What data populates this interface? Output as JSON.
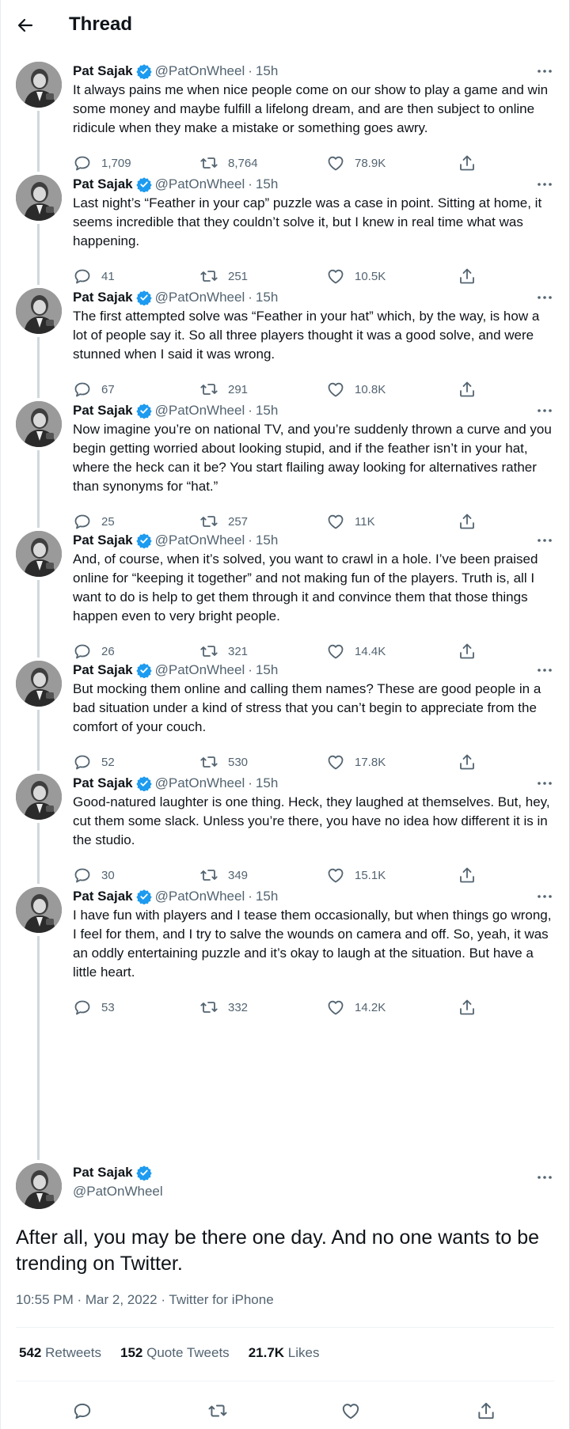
{
  "header": {
    "title": "Thread"
  },
  "author": {
    "name": "Pat Sajak",
    "handle": "@PatOnWheel",
    "time": "15h",
    "separator": "·"
  },
  "thread": [
    {
      "text": "It always pains me when nice people come on our show to play a game and win some money and maybe fulfill a lifelong dream, and are then subject to online ridicule when they make a mistake or something goes awry.",
      "replies": "1,709",
      "retweets": "8,764",
      "likes": "78.9K"
    },
    {
      "text": "Last night’s “Feather in your cap” puzzle was a case in point. Sitting at home, it seems incredible that they couldn’t solve it, but I knew in real time what was happening.",
      "replies": "41",
      "retweets": "251",
      "likes": "10.5K"
    },
    {
      "text": "The first attempted solve was “Feather in your hat” which, by the way, is how a lot of people say it. So all three players thought it was a good solve, and were stunned when I said it was wrong.",
      "replies": "67",
      "retweets": "291",
      "likes": "10.8K"
    },
    {
      "text": "Now imagine you’re on national TV, and you’re suddenly thrown a curve and you begin getting worried about looking stupid, and if the feather isn’t in your hat, where the heck can it be? You start flailing away looking for alternatives rather than synonyms for “hat.”",
      "replies": "25",
      "retweets": "257",
      "likes": "11K"
    },
    {
      "text": "And, of course, when it’s solved, you want to crawl in a hole. I’ve been praised online for “keeping it together” and not making fun of the players. Truth is, all I want to do is help to get them through it and convince them that those things happen even to very bright people.",
      "replies": "26",
      "retweets": "321",
      "likes": "14.4K"
    },
    {
      "text": "But mocking them online and calling them names? These are good people in a bad situation under a kind of stress that you can’t begin to appreciate from the comfort of your couch.",
      "replies": "52",
      "retweets": "530",
      "likes": "17.8K"
    },
    {
      "text": "Good-natured laughter is one thing. Heck, they laughed at themselves. But, hey, cut them some slack. Unless you’re there, you have no idea how different it is in the studio.",
      "replies": "30",
      "retweets": "349",
      "likes": "15.1K"
    },
    {
      "text": "I have fun with players and I tease them occasionally, but when things go wrong, I feel for them, and I try to salve the wounds on camera and off. So, yeah, it was an oddly entertaining puzzle and it’s okay to laugh at the situation. But have a little heart.",
      "replies": "53",
      "retweets": "332",
      "likes": "14.2K"
    }
  ],
  "main": {
    "text": "After all, you may be there one day. And no one wants to be trending on Twitter.",
    "timestamp": "10:55 PM · Mar 2, 2022 · Twitter for iPhone",
    "retweets_count": "542",
    "retweets_label": "Retweets",
    "quotes_count": "152",
    "quotes_label": "Quote Tweets",
    "likes_count": "21.7K",
    "likes_label": "Likes"
  },
  "colors": {
    "verified": "#1d9bf0",
    "secondary": "#536471",
    "line": "#cfd9de"
  },
  "icons": [
    "back-arrow-icon",
    "verified-icon",
    "more-icon",
    "reply-icon",
    "retweet-icon",
    "like-icon",
    "share-icon"
  ]
}
